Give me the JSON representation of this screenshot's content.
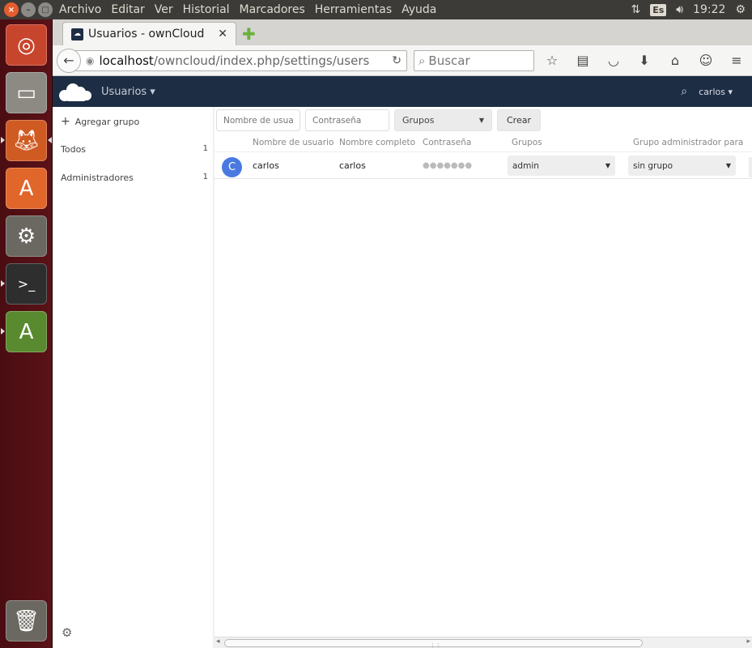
{
  "top_panel": {
    "menus": [
      "Archivo",
      "Editar",
      "Ver",
      "Historial",
      "Marcadores",
      "Herramientas",
      "Ayuda"
    ],
    "keyboard_layout": "Es",
    "clock": "19:22"
  },
  "browser": {
    "tab_title": "Usuarios - ownCloud",
    "url_host": "localhost",
    "url_path": "/owncloud/index.php/settings/users",
    "search_placeholder": "Buscar"
  },
  "owncloud": {
    "app_name": "Usuarios ▾",
    "user_menu": "carlos ▾",
    "sidebar": {
      "add_group": "Agregar grupo",
      "groups": [
        {
          "label": "Todos",
          "count": "1"
        },
        {
          "label": "Administradores",
          "count": "1"
        }
      ]
    },
    "create_form": {
      "username_placeholder": "Nombre de usuar",
      "password_placeholder": "Contraseña",
      "groups_select": "Grupos",
      "create_button": "Crear"
    },
    "table": {
      "headers": [
        "Nombre de usuario",
        "Nombre completo",
        "Contraseña",
        "Grupos",
        "Grupo administrador para"
      ],
      "rows": [
        {
          "avatar_letter": "C",
          "username": "carlos",
          "full_name": "carlos",
          "password": "●●●●●●●",
          "group": "admin",
          "admin_group": "sin grupo"
        }
      ]
    }
  },
  "colors": {
    "oc_header": "#1d2d44",
    "avatar": "#4a7ae0",
    "launcher": "#5a1217"
  }
}
